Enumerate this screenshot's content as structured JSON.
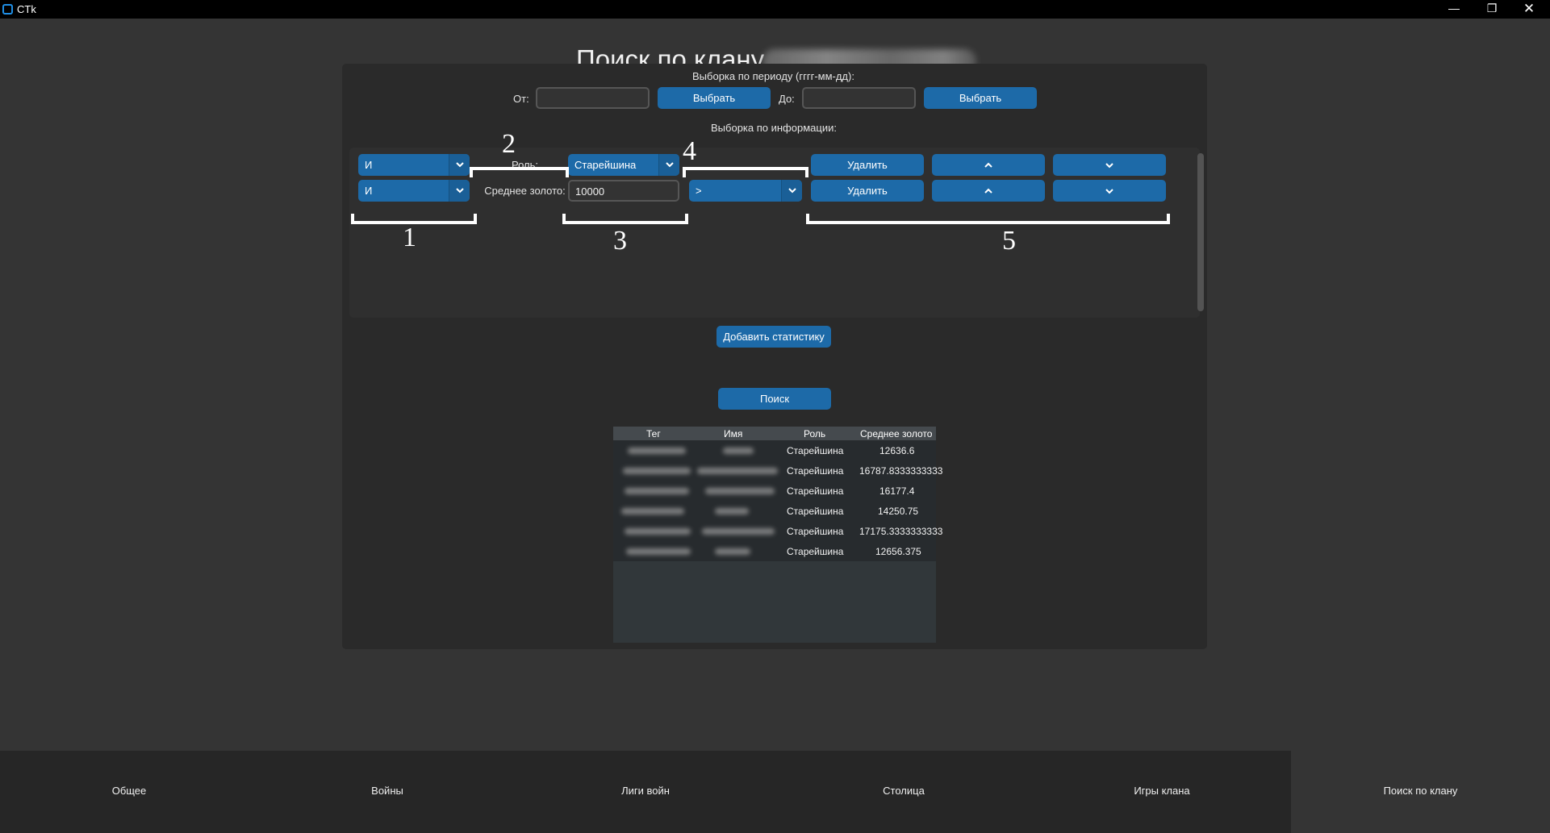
{
  "window": {
    "title": "CTk",
    "controls": {
      "minimize": "—",
      "maximize": "❐",
      "close": "✕"
    }
  },
  "page": {
    "title": "Поиск по клану"
  },
  "period": {
    "label": "Выборка по периоду (гггг-мм-дд):",
    "from_label": "От:",
    "from_value": "",
    "from_button": "Выбрать",
    "to_label": "До:",
    "to_value": "",
    "to_button": "Выбрать"
  },
  "info": {
    "label": "Выборка по информации:",
    "rows": [
      {
        "logic": "И",
        "field_label": "Роль:",
        "value": "Старейшина",
        "operator": "",
        "delete_label": "Удалить"
      },
      {
        "logic": "И",
        "field_label": "Среднее золото:",
        "value": "10000",
        "operator": ">",
        "delete_label": "Удалить"
      }
    ]
  },
  "annotations": [
    "1",
    "2",
    "3",
    "4",
    "5"
  ],
  "add_stat_button": "Добавить статистику",
  "search_button": "Поиск",
  "results": {
    "columns": [
      "Тег",
      "Имя",
      "Роль",
      "Среднее золото"
    ],
    "rows": [
      {
        "tag": "",
        "name": "",
        "role": "Старейшина",
        "avg_gold": "12636.6"
      },
      {
        "tag": "",
        "name": "",
        "role": "Старейшина",
        "avg_gold": "16787.8333333333"
      },
      {
        "tag": "",
        "name": "",
        "role": "Старейшина",
        "avg_gold": "16177.4"
      },
      {
        "tag": "",
        "name": "",
        "role": "Старейшина",
        "avg_gold": "14250.75"
      },
      {
        "tag": "",
        "name": "",
        "role": "Старейшина",
        "avg_gold": "17175.3333333333"
      },
      {
        "tag": "",
        "name": "",
        "role": "Старейшина",
        "avg_gold": "12656.375"
      }
    ]
  },
  "nav": {
    "items": [
      {
        "label": "Общее",
        "active": false
      },
      {
        "label": "Войны",
        "active": false
      },
      {
        "label": "Лиги войн",
        "active": false
      },
      {
        "label": "Столица",
        "active": false
      },
      {
        "label": "Игры клана",
        "active": false
      },
      {
        "label": "Поиск по клану",
        "active": true
      }
    ]
  },
  "colors": {
    "accent": "#1d6aa8",
    "background": "#343434",
    "panel": "#2a2a2a"
  }
}
